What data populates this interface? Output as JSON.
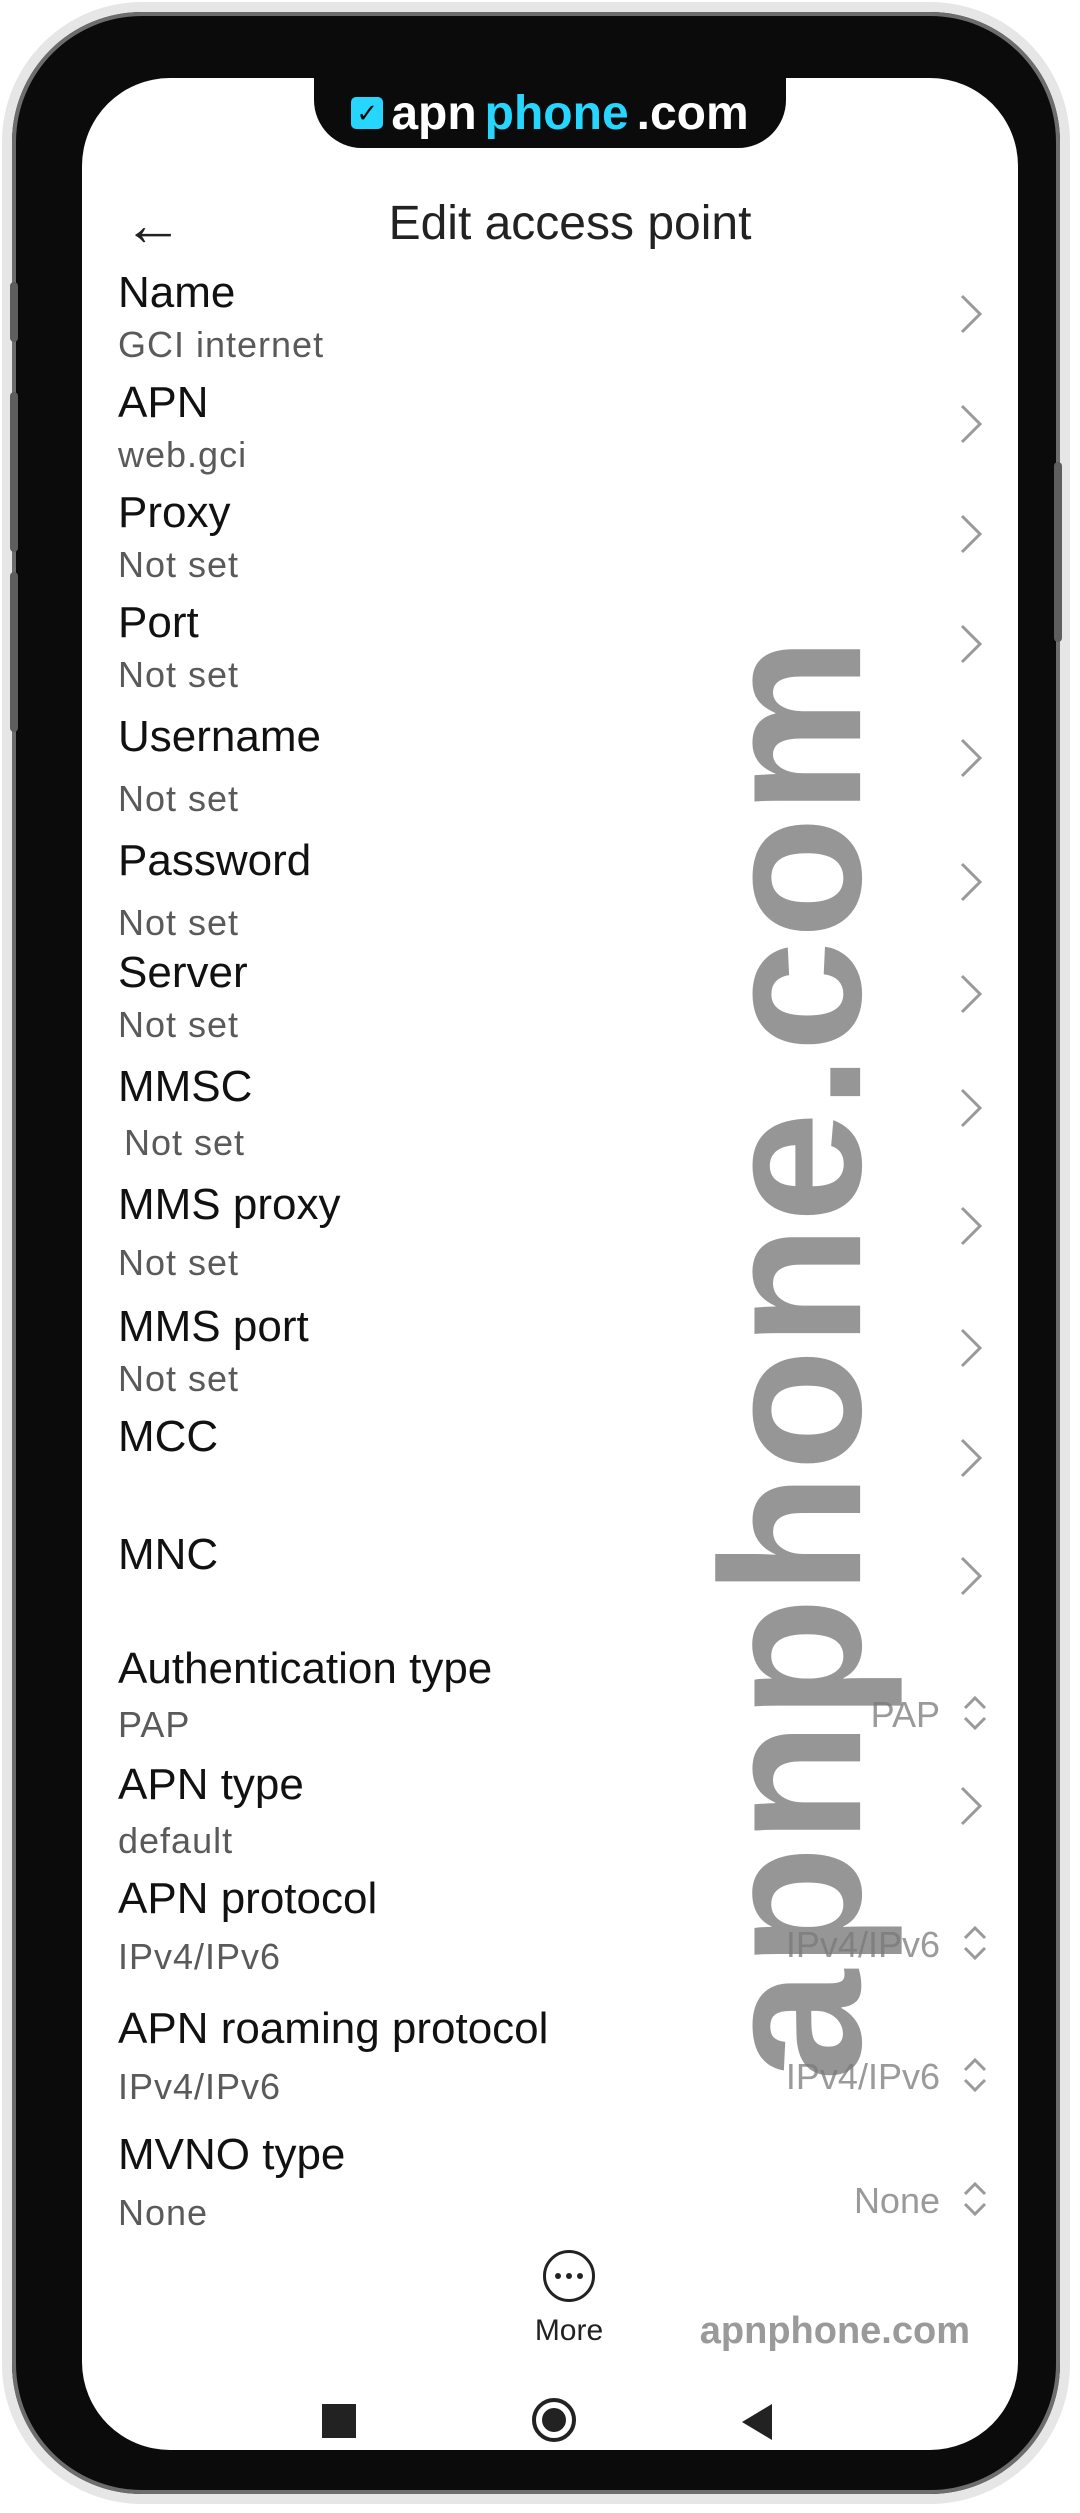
{
  "notch": {
    "logo_apn": "apn",
    "logo_phone": "phone",
    "logo_com": ".com",
    "logo_check": "✓"
  },
  "header": {
    "back_icon": "←",
    "title": "Edit access point"
  },
  "settings": [
    {
      "label": "Name",
      "value": "GCI internet"
    },
    {
      "label": "APN",
      "value": "web.gci"
    },
    {
      "label": "Proxy",
      "value": "Not set"
    },
    {
      "label": "Port",
      "value": "Not set"
    },
    {
      "label": "Username",
      "value": "Not set"
    },
    {
      "label": "Password",
      "value": "Not set"
    },
    {
      "label": "Server",
      "value": "Not set"
    },
    {
      "label": "MMSC",
      "value": "Not set"
    },
    {
      "label": "MMS proxy",
      "value": "Not set"
    },
    {
      "label": "MMS port",
      "value": "Not set"
    },
    {
      "label": "MCC",
      "value": ""
    },
    {
      "label": "MNC",
      "value": ""
    },
    {
      "label": "Authentication type",
      "value": "PAP",
      "selected": "PAP"
    },
    {
      "label": "APN type",
      "value": "default"
    },
    {
      "label": "APN protocol",
      "value": "IPv4/IPv6",
      "selected": "IPv4/IPv6"
    },
    {
      "label": "APN roaming protocol",
      "value": "IPv4/IPv6",
      "selected": "IPv4/IPv6"
    },
    {
      "label": "MVNO type",
      "value": "None",
      "selected": "None"
    }
  ],
  "more_label": "More",
  "watermark": "apnphone.com",
  "brand_bottom": "apnphone.com"
}
